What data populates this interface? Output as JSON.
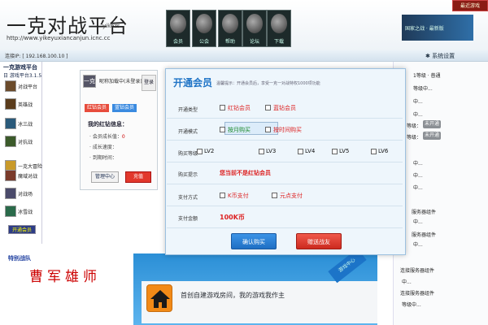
{
  "header": {
    "logo": "一克对战平台",
    "logo_sub": "yikezs",
    "url": "http://www.yikeyuxiancanjun.icnc.cc",
    "icons": [
      {
        "label": "会员",
        "icon": "member-icon"
      },
      {
        "label": "公会",
        "icon": "guild-icon"
      },
      {
        "label": "帮助",
        "icon": "help-icon"
      },
      {
        "label": "论坛",
        "icon": "forum-icon"
      },
      {
        "label": "下载",
        "icon": "download-icon"
      }
    ],
    "banner_text": "国家之战 · 最新版",
    "corner_button": "最近游戏"
  },
  "statusbar": {
    "text": "连接IP: [ 192.168.100.10 ]",
    "settings": "系统设置"
  },
  "tree": {
    "title": "一克游戏平台",
    "subtitle": "日 游戏平台3.1.5",
    "items": [
      {
        "label": "对战平台"
      },
      {
        "label": "英雄战"
      },
      {
        "label": "冰三战"
      },
      {
        "label": "对抗战"
      },
      {
        "label": "一克大冒险"
      },
      {
        "label": "魔域对战"
      },
      {
        "label": "对战场"
      },
      {
        "label": "冰雪战"
      }
    ],
    "bottom_button": "开通会员"
  },
  "login_panel": {
    "avatar_text": "一克",
    "nickname": "昵称加载中(未登录)",
    "login_button": "登录",
    "tab_redvip": "红钻会员",
    "tab_bluevip": "蓝钻会员",
    "my_title": "我的红钻信息：",
    "info": [
      {
        "label": "· 会员成长值：",
        "value": "0"
      },
      {
        "label": "· 成长速度：",
        "value": ""
      },
      {
        "label": "· 到期时间：",
        "value": ""
      }
    ],
    "mgmt_button": "管理中心",
    "recharge_button": "充值"
  },
  "modal": {
    "title": "开通会员",
    "hint": "温馨提示：开通会员后，享受一克一对战特权1000项功能",
    "rows": {
      "vip_type": {
        "label": "开通类型",
        "options": [
          "红钻会员",
          "蓝钻会员"
        ]
      },
      "method": {
        "label": "开通模式",
        "options": [
          "按月购买",
          "按时间购买"
        ]
      },
      "level": {
        "label": "购买等级",
        "options": [
          "LV2",
          "LV3",
          "LV4",
          "LV5",
          "LV6"
        ]
      },
      "tip": {
        "label": "购买提示",
        "text": "您当前不是红钻会员"
      },
      "payment": {
        "label": "支付方式",
        "options": [
          "K币支付",
          "元点支付"
        ]
      },
      "amount": {
        "label": "支付金额",
        "text": "100K币"
      }
    },
    "confirm_button": "确认购买",
    "gift_button": "赠送战友"
  },
  "bottom_left": {
    "special_label": "特别战队",
    "cao_text": "曹军雄师"
  },
  "promo": {
    "text": "首创自建游戏房间，我的游戏我作主",
    "ribbon": "游戏中心"
  },
  "right_panel": {
    "lines": [
      {
        "text": "1等级 · 普通"
      },
      {
        "text": "等级中..."
      },
      {
        "text": "中..."
      },
      {
        "text": "中..."
      },
      {
        "text": "等级："
      },
      {
        "text": "等级："
      },
      {
        "text": "中..."
      },
      {
        "text": "中..."
      },
      {
        "text": "中..."
      },
      {
        "text": "服务器组件"
      },
      {
        "text": "中..."
      },
      {
        "text": "服务器组件"
      },
      {
        "text": "中..."
      },
      {
        "text": "连接服务器组件"
      },
      {
        "text": "中..."
      },
      {
        "text": "连接服务器组件"
      },
      {
        "text": "等级中..."
      }
    ],
    "buttons": [
      "未开通",
      "未开通"
    ]
  }
}
